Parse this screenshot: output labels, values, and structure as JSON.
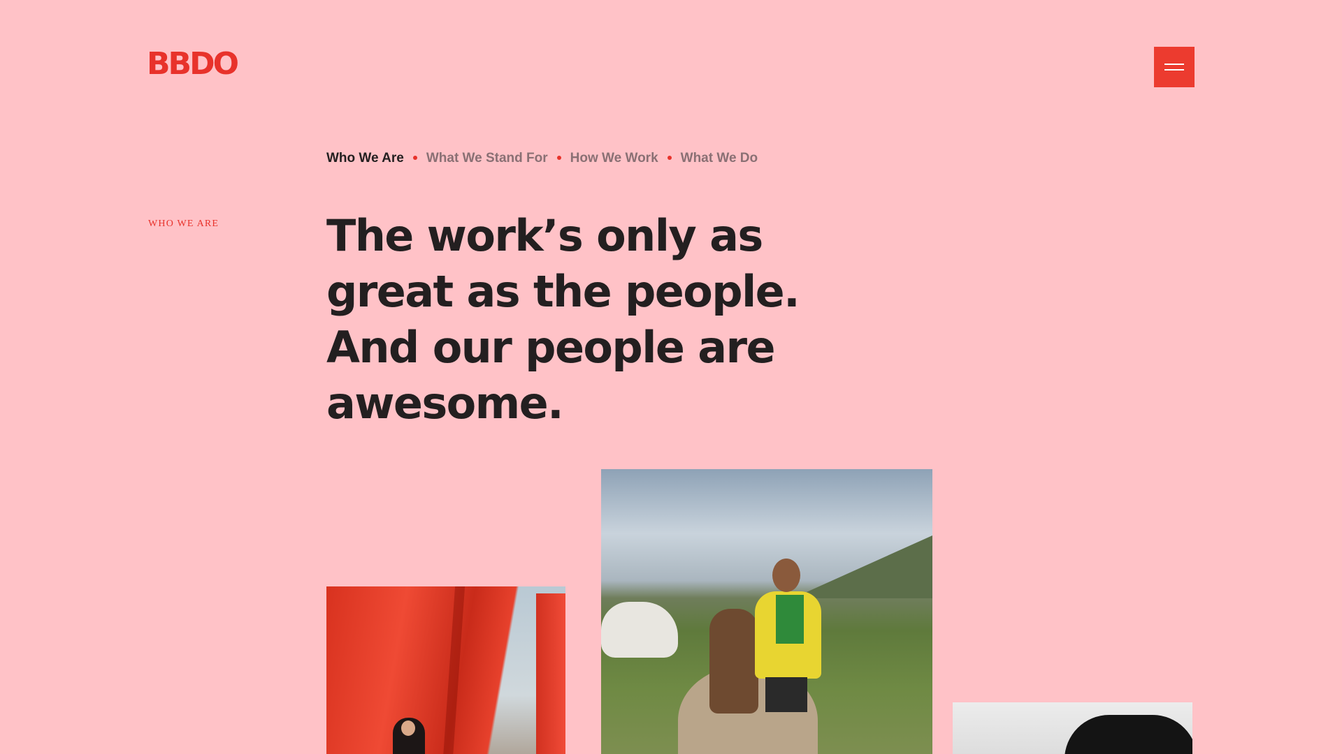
{
  "brand": {
    "logo_text": "BBDO",
    "accent_color": "#e8322b",
    "background_color": "#ffc2c7"
  },
  "header": {
    "menu_icon": "hamburger-menu-icon"
  },
  "subnav": {
    "items": [
      {
        "label": "Who We Are",
        "active": true
      },
      {
        "label": "What We Stand For",
        "active": false
      },
      {
        "label": "How We Work",
        "active": false
      },
      {
        "label": "What We Do",
        "active": false
      }
    ]
  },
  "section": {
    "label": "WHO WE ARE",
    "headline": "The work’s only as great as the people. And our people are awesome."
  }
}
